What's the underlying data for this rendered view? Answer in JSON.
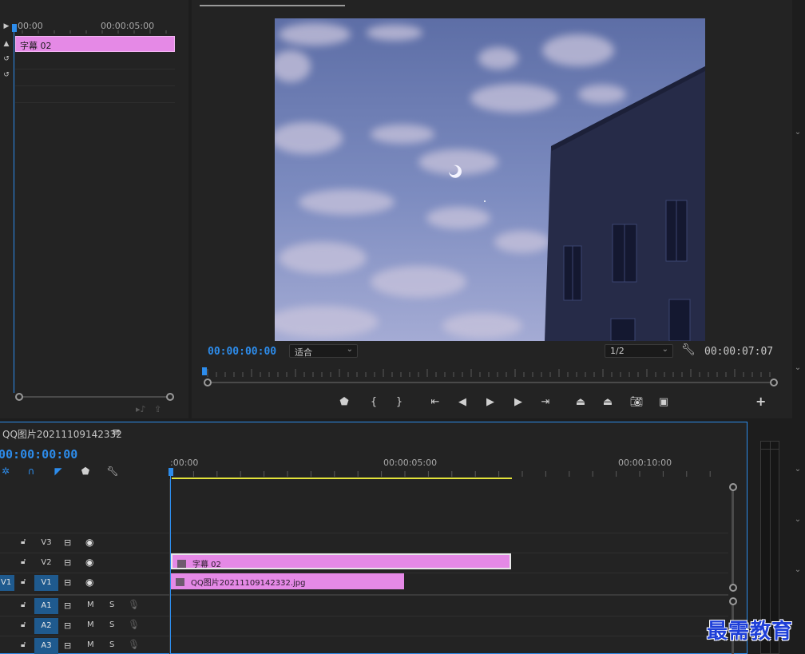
{
  "source_panel": {
    "ruler_start": "00:00",
    "ruler_end": "00:00:05:00",
    "clip_label": "字幕 02"
  },
  "program_monitor": {
    "timecode_current": "00:00:00:00",
    "zoom_value": "适合",
    "resolution_value": "1/2",
    "timecode_duration": "00:00:07:07",
    "controls": [
      "add-marker",
      "mark-in",
      "mark-out",
      "go-to-in",
      "step-back",
      "play",
      "step-forward",
      "go-to-out",
      "lift",
      "extract",
      "export-frame",
      "compare"
    ]
  },
  "timeline": {
    "sequence_name": "QQ图片20211109142332",
    "menu_icon": "≡",
    "timecode": "00:00:00:00",
    "ruler_labels": [
      ":00:00",
      "00:00:05:00",
      "00:00:10:00"
    ],
    "tracks": [
      {
        "name": "V3",
        "type": "video",
        "targeted": false
      },
      {
        "name": "V2",
        "type": "video",
        "targeted": false
      },
      {
        "name": "V1",
        "type": "video",
        "targeted": true,
        "source": "V1"
      },
      {
        "name": "A1",
        "type": "audio",
        "targeted": true
      },
      {
        "name": "A2",
        "type": "audio",
        "targeted": true
      },
      {
        "name": "A3",
        "type": "audio",
        "targeted": true
      }
    ],
    "audio_m": "M",
    "audio_s": "S",
    "clips": {
      "title_clip": "字幕 02",
      "image_clip": "QQ图片20211109142332.jpg"
    }
  },
  "watermark": "最需教育",
  "colors": {
    "accent": "#2d8ceb",
    "clip": "#e589e6",
    "work_area": "#e3e33a",
    "background": "#232323"
  }
}
